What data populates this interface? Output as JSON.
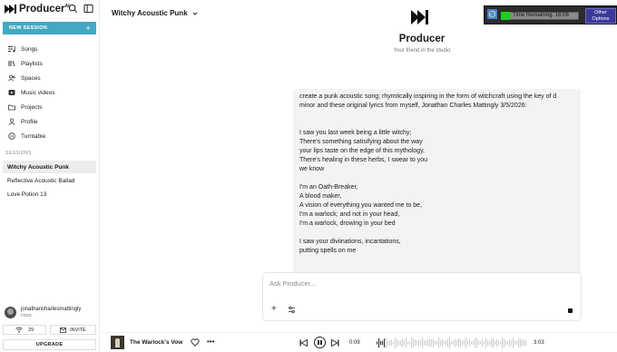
{
  "app": {
    "name": "Producer",
    "name_badge": "AI",
    "tagline": "Your friend in the studio"
  },
  "sidebar": {
    "new_session_label": "NEW SESSION",
    "new_session_icon": "+",
    "nav": [
      {
        "label": "Songs",
        "icon": "songs-icon"
      },
      {
        "label": "Playlists",
        "icon": "playlists-icon"
      },
      {
        "label": "Spaces",
        "icon": "spaces-icon"
      },
      {
        "label": "Music videos",
        "icon": "music-videos-icon"
      },
      {
        "label": "Projects",
        "icon": "projects-icon"
      },
      {
        "label": "Profile",
        "icon": "profile-icon"
      },
      {
        "label": "Turntable",
        "icon": "turntable-icon"
      }
    ],
    "sessions_label": "SESSIONS",
    "sessions": [
      {
        "label": "Witchy Acoustic Punk",
        "active": true
      },
      {
        "label": "Reflective Acoustic Ballad",
        "active": false
      },
      {
        "label": "Love Potion 13",
        "active": false
      }
    ],
    "user": {
      "name": "jonathancharlesmattingly",
      "plan": "FREE"
    },
    "credits": "29",
    "invite_label": "INVITE",
    "upgrade_label": "UPGRADE"
  },
  "header": {
    "session_title": "Witchy Acoustic Punk"
  },
  "message": {
    "paragraphs": [
      "create a punk acoustic song; rhymtically inspiring in the form of witchcraft using the key of d minor and these original lyrics from myself, Jonathan Charles Mattingly 3/5/2026:",
      "I saw you last week being a little witchy;\nThere's something satisifying about the way\nyour lips taste on the edge of this mythology,\nThere's healing in these herbs, I swear to you\nwe know",
      "I'm an Oath-Breaker,\nA blood maker,\nA vision of everything you wanted me to be,\nI'm a warlock; and not in your head,\nI'm a warlock, drowing in your bed",
      "I saw your diviinations, incantations,\nputting spells on me"
    ]
  },
  "composer": {
    "placeholder": "Ask Producer..."
  },
  "player": {
    "track_title": "The Warlock's Vow",
    "current_time": "0:09",
    "duration": "3:03",
    "progress_fraction": 0.05
  },
  "timer_overlay": {
    "label": "Time Remaining: 16:06",
    "other_options_line1": "Other",
    "other_options_line2": "Options"
  }
}
